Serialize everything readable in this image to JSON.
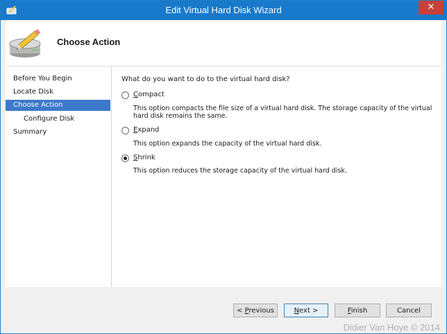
{
  "window": {
    "title": "Edit Virtual Hard Disk Wizard",
    "close_glyph": "✕"
  },
  "header": {
    "title": "Choose Action",
    "icon": "disk-pencil-icon"
  },
  "nav": {
    "items": [
      {
        "label": "Before You Begin",
        "active": false,
        "sub": false
      },
      {
        "label": "Locate Disk",
        "active": false,
        "sub": false
      },
      {
        "label": "Choose Action",
        "active": true,
        "sub": false
      },
      {
        "label": "Configure Disk",
        "active": false,
        "sub": true
      },
      {
        "label": "Summary",
        "active": false,
        "sub": false
      }
    ]
  },
  "content": {
    "question": "What do you want to do to the virtual hard disk?",
    "options": [
      {
        "label": "Compact",
        "description": "This option compacts the file size of a virtual hard disk. The storage capacity of the virtual hard disk remains the same.",
        "selected": false
      },
      {
        "label": "Expand",
        "description": "This option expands the capacity of the virtual hard disk.",
        "selected": false
      },
      {
        "label": "Shrink",
        "description": "This option reduces the storage capacity of the virtual hard disk.",
        "selected": true
      }
    ]
  },
  "footer": {
    "previous_label": "< Previous",
    "next_label": "Next >",
    "finish_label": "Finish",
    "cancel_label": "Cancel"
  },
  "watermark": "Didier Van Hoye © 2014",
  "colors": {
    "titlebar": "#1979ca",
    "selection": "#3d79cb",
    "close": "#c7403a"
  }
}
